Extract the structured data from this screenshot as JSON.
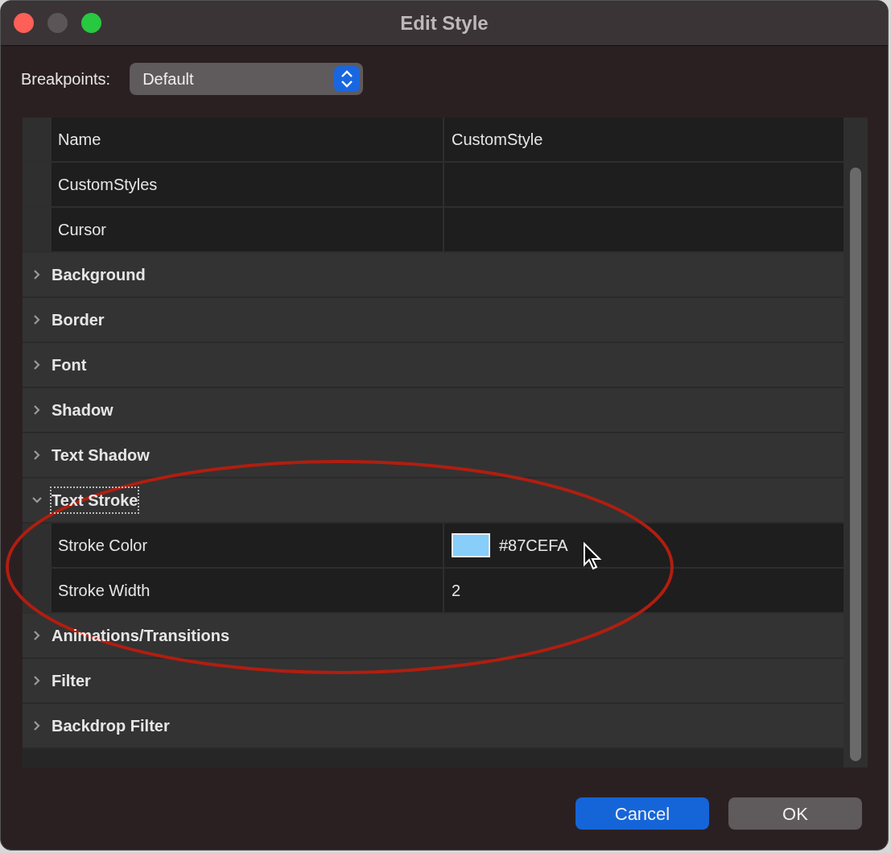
{
  "window": {
    "title": "Edit Style"
  },
  "breakpoints": {
    "label": "Breakpoints:",
    "value": "Default"
  },
  "rows": [
    {
      "kind": "property",
      "label": "Name",
      "value": "CustomStyle"
    },
    {
      "kind": "property",
      "label": "CustomStyles"
    },
    {
      "kind": "property",
      "label": "Cursor"
    },
    {
      "kind": "group",
      "label": "Background",
      "expanded": false,
      "focused": false
    },
    {
      "kind": "group",
      "label": "Border",
      "expanded": false,
      "focused": false
    },
    {
      "kind": "group",
      "label": "Font",
      "expanded": false,
      "focused": false
    },
    {
      "kind": "group",
      "label": "Shadow",
      "expanded": false,
      "focused": false
    },
    {
      "kind": "group",
      "label": "Text Shadow",
      "expanded": false,
      "focused": false
    },
    {
      "kind": "group",
      "label": "Text Stroke",
      "expanded": true,
      "focused": true,
      "children": [
        {
          "kind": "property",
          "label": "Stroke Color",
          "value": "#87CEFA",
          "color": "#87cefa"
        },
        {
          "kind": "property",
          "label": "Stroke Width",
          "value": "2"
        }
      ]
    },
    {
      "kind": "group",
      "label": "Animations/Transitions",
      "expanded": false,
      "focused": false
    },
    {
      "kind": "group",
      "label": "Filter",
      "expanded": false,
      "focused": false
    },
    {
      "kind": "group",
      "label": "Backdrop Filter",
      "expanded": false,
      "focused": false
    }
  ],
  "buttons": [
    {
      "label": "Cancel",
      "kind": "primary"
    },
    {
      "label": "OK",
      "kind": "secondary"
    }
  ]
}
